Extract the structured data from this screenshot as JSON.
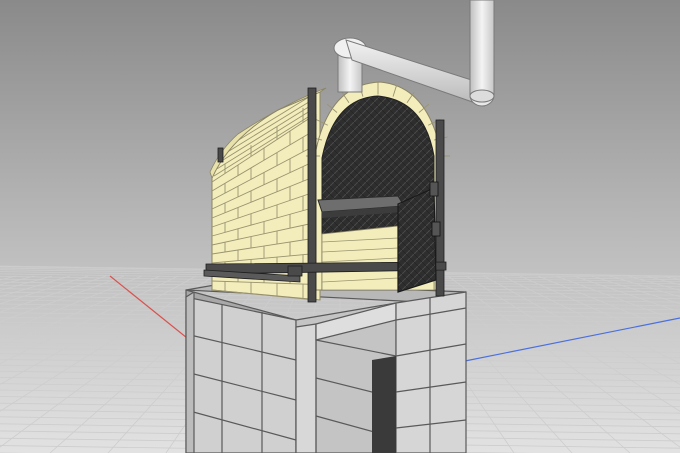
{
  "viewport": {
    "kind": "3d-cad-viewport",
    "background_colors": [
      "#8e8e8e",
      "#d4d4d4"
    ],
    "grid_color": "#c8c8c8",
    "x_axis_color": "#d9534f",
    "y_axis_color": "#4a6fe0"
  },
  "model": {
    "name": "brick-oven",
    "parts": [
      "cinder-block-base",
      "fire-brick-arch",
      "steel-frame",
      "oven-door",
      "chimney-pipe",
      "cooking-grate"
    ],
    "colors": {
      "brick": "#f3edbc",
      "brick_mortar": "#9a9470",
      "cinder_block": "#d2d2d2",
      "cinder_block_edge": "#5a5a5a",
      "steel": "#4a4a4a",
      "door": "#2b2b2b",
      "pipe": "#e6e6e6"
    }
  }
}
